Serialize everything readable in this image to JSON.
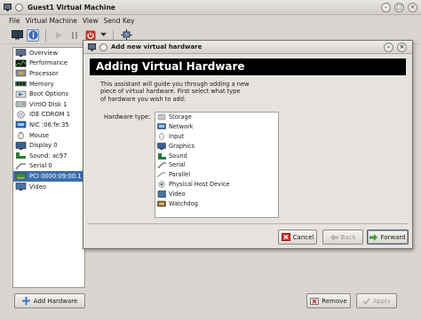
{
  "window": {
    "title": "Guest1 Virtual Machine"
  },
  "menu": [
    "File",
    "Virtual Machine",
    "View",
    "Send Key"
  ],
  "sidebar": {
    "items": [
      {
        "label": "Overview",
        "icon": "overview-icon"
      },
      {
        "label": "Performance",
        "icon": "performance-icon"
      },
      {
        "label": "Processor",
        "icon": "processor-icon"
      },
      {
        "label": "Memory",
        "icon": "memory-icon"
      },
      {
        "label": "Boot Options",
        "icon": "boot-options-icon"
      },
      {
        "label": "VirtIO Disk 1",
        "icon": "disk-icon"
      },
      {
        "label": "IDE CDROM 1",
        "icon": "cdrom-icon"
      },
      {
        "label": "NIC :06:fe:35",
        "icon": "nic-icon"
      },
      {
        "label": "Mouse",
        "icon": "mouse-icon"
      },
      {
        "label": "Display 0",
        "icon": "display-icon"
      },
      {
        "label": "Sound: ac97",
        "icon": "sound-icon"
      },
      {
        "label": "Serial 0",
        "icon": "serial-icon"
      },
      {
        "label": "PCI 0000:09:00.1",
        "icon": "pci-icon",
        "selected": true
      },
      {
        "label": "Video",
        "icon": "video-icon"
      }
    ],
    "add_label": "Add Hardware"
  },
  "bottom": {
    "remove_label": "Remove",
    "apply_label": "Apply"
  },
  "dialog": {
    "title": "Add new virtual hardware",
    "header": "Adding Virtual Hardware",
    "intro_lines": [
      "This assistant will guide you through adding a new",
      "piece of virtual hardware. First select what type",
      "of hardware you wish to add:"
    ],
    "hardware_label": "Hardware type:",
    "hardware_types": [
      {
        "label": "Storage",
        "icon": "storage-icon"
      },
      {
        "label": "Network",
        "icon": "network-icon"
      },
      {
        "label": "Input",
        "icon": "input-icon"
      },
      {
        "label": "Graphics",
        "icon": "graphics-icon"
      },
      {
        "label": "Sound",
        "icon": "sound-icon"
      },
      {
        "label": "Serial",
        "icon": "serial-icon"
      },
      {
        "label": "Parallel",
        "icon": "parallel-icon"
      },
      {
        "label": "Physical Host Device",
        "icon": "host-device-icon"
      },
      {
        "label": "Video",
        "icon": "video-icon"
      },
      {
        "label": "Watchdog",
        "icon": "watchdog-icon"
      }
    ],
    "cancel_label": "Cancel",
    "back_label": "Back",
    "forward_label": "Forward"
  },
  "colors": {
    "selection": "#3b6eb0",
    "header_bg": "#000000"
  }
}
